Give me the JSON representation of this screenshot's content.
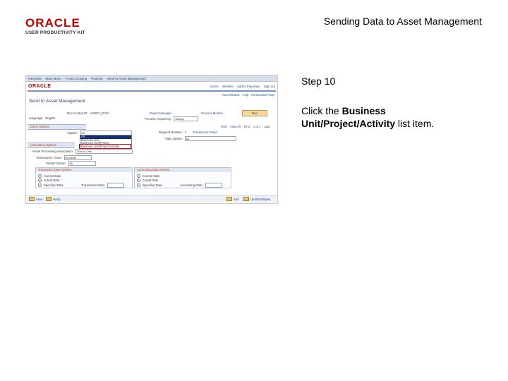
{
  "header": {
    "logo_word": "ORACLE",
    "logo_sub": "USER PRODUCTIVITY KIT",
    "doc_title": "Sending Data to Asset Management"
  },
  "instructions": {
    "step": "Step 10",
    "prefix": "Click the ",
    "bold": "Business Unit/Project/Activity",
    "suffix": " list item."
  },
  "screenshot": {
    "nav_items": [
      "Favorites",
      "Main Menu",
      "Project Costing",
      "Projects",
      "Send to Asset Management"
    ],
    "brand": "ORACLE",
    "top_links": [
      "Home",
      "Worklist",
      "Add to Favorites",
      "Sign out"
    ],
    "page_links": [
      "New Window",
      "Help",
      "Personalize Page"
    ],
    "page_title": "Send to Asset Management",
    "run_control_label": "Run Control ID:",
    "run_control_value": "ASSET_DATA",
    "report_manager": "Report Manager",
    "process_monitor": "Process Monitor",
    "run_button": "Run",
    "language_label": "Language:",
    "language_value": "English",
    "request_id_label": "Request ID:",
    "request_id_value": "1",
    "process_freq_label": "Process Frequency:",
    "process_freq_value": "Always",
    "section_select": "Select Options",
    "grid_find": "Find",
    "grid_viewall": "View All",
    "grid_first": "First",
    "grid_range": "1 of 1",
    "grid_last": "Last",
    "option_label": "*Option:",
    "option_value": "All",
    "request_number_label": "Request Number:",
    "request_number_value": "1",
    "trans_detail": "Transaction Detail",
    "date_option_label": "*Date Option:",
    "date_option_value": "All",
    "dropdown_items": [
      "All",
      "Business Unit",
      "Business Unit/Project",
      "Business Unit/Project/Activity"
    ],
    "section_association": "Association Options",
    "assoc_label": "*Asset Processing Association:",
    "assoc_value": "One-to-One",
    "summarize_label": "*Summarize Trans:",
    "summarize_value": "By Asset",
    "vendor_label": "Vendor Option:",
    "vendor_value": "All",
    "box_trans_title": "Transaction Date Options",
    "box_acct_title": "Accounting Date Options",
    "trans_options": [
      "Current Date",
      "Actual Date",
      "Specified Date"
    ],
    "acct_options": [
      "Current Date",
      "Actual Date",
      "Specified Date"
    ],
    "trans_date_label": "Transaction Date:",
    "acct_date_label": "Accounting Date:",
    "footer_save": "Save",
    "footer_notify": "Notify",
    "footer_add": "Add",
    "footer_update": "Update/Display"
  },
  "colors": {
    "oracle_red": "#c00000",
    "highlight_red": "#e0001b",
    "selection_blue": "#12316e"
  }
}
